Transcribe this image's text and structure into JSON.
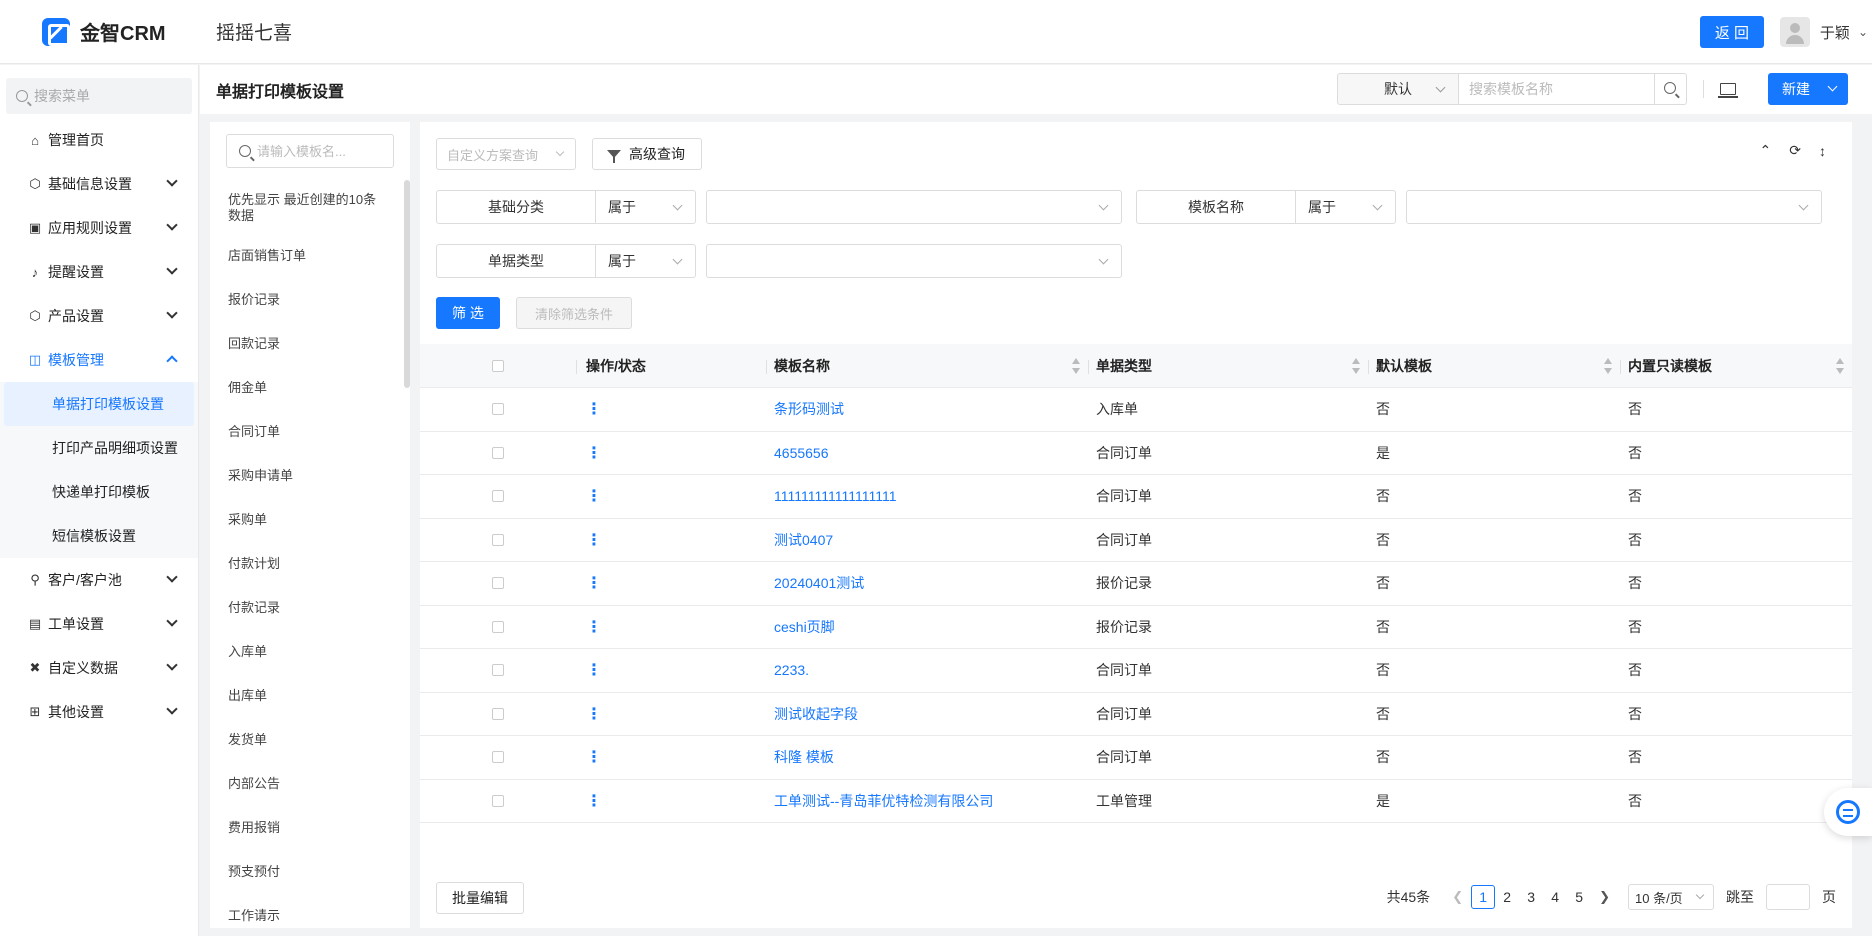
{
  "topbar": {
    "brand": "金智CRM",
    "company": "摇摇七喜",
    "back_label": "返 回",
    "user_name": "于颖"
  },
  "sidebar": {
    "search_placeholder": "搜索菜单",
    "items": [
      {
        "label": "管理首页",
        "icon": "home-icon"
      },
      {
        "label": "基础信息设置",
        "icon": "cube-icon"
      },
      {
        "label": "应用规则设置",
        "icon": "document-icon"
      },
      {
        "label": "提醒设置",
        "icon": "bell-icon"
      },
      {
        "label": "产品设置",
        "icon": "cube-icon"
      },
      {
        "label": "模板管理",
        "icon": "template-icon"
      },
      {
        "label": "客户/客户池",
        "icon": "customer-icon"
      },
      {
        "label": "工单设置",
        "icon": "ticket-icon"
      },
      {
        "label": "自定义数据",
        "icon": "tools-icon"
      },
      {
        "label": "其他设置",
        "icon": "grid-icon"
      }
    ],
    "submenu": [
      "单据打印模板设置",
      "打印产品明细项设置",
      "快递单打印模板",
      "短信模板设置"
    ]
  },
  "page": {
    "title": "单据打印模板设置",
    "scheme_value": "默认",
    "search_placeholder": "搜索模板名称",
    "new_label": "新建"
  },
  "categories": {
    "search_placeholder": "请输入模板名...",
    "items": [
      "优先显示 最近创建的10条数据",
      "店面销售订单",
      "报价记录",
      "回款记录",
      "佣金单",
      "合同订单",
      "采购申请单",
      "采购单",
      "付款计划",
      "付款记录",
      "入库单",
      "出库单",
      "发货单",
      "内部公告",
      "费用报销",
      "预支预付",
      "工作请示"
    ]
  },
  "filters": {
    "custom_query_placeholder": "自定义方案查询",
    "advanced_label": "高级查询",
    "rows": [
      [
        {
          "label": "基础分类",
          "op": "属于"
        },
        {
          "label": "模板名称",
          "op": "属于"
        }
      ],
      [
        {
          "label": "单据类型",
          "op": "属于"
        }
      ]
    ],
    "filter_label": "筛 选",
    "clear_label": "清除筛选条件"
  },
  "table": {
    "headers": {
      "op": "操作/状态",
      "name": "模板名称",
      "type": "单据类型",
      "default": "默认模板",
      "readonly": "内置只读模板"
    },
    "rows": [
      {
        "name": "条形码测试",
        "type": "入库单",
        "default": "否",
        "readonly": "否"
      },
      {
        "name": "4655656",
        "type": "合同订单",
        "default": "是",
        "readonly": "否"
      },
      {
        "name": "111111111111111111",
        "type": "合同订单",
        "default": "否",
        "readonly": "否"
      },
      {
        "name": "测试0407",
        "type": "合同订单",
        "default": "否",
        "readonly": "否"
      },
      {
        "name": "20240401测试",
        "type": "报价记录",
        "default": "否",
        "readonly": "否"
      },
      {
        "name": "ceshi页脚",
        "type": "报价记录",
        "default": "否",
        "readonly": "否"
      },
      {
        "name": "2233.",
        "type": "合同订单",
        "default": "否",
        "readonly": "否"
      },
      {
        "name": "测试收起字段",
        "type": "合同订单",
        "default": "否",
        "readonly": "否"
      },
      {
        "name": "科隆 模板",
        "type": "合同订单",
        "default": "否",
        "readonly": "否"
      },
      {
        "name": "工单测试--青岛菲优特检测有限公司",
        "type": "工单管理",
        "default": "是",
        "readonly": "否"
      }
    ]
  },
  "footer": {
    "batch_label": "批量编辑",
    "total": "共45条",
    "pages": [
      "1",
      "2",
      "3",
      "4",
      "5"
    ],
    "page_size": "10 条/页",
    "jump_label": "跳至",
    "page_suffix": "页"
  }
}
